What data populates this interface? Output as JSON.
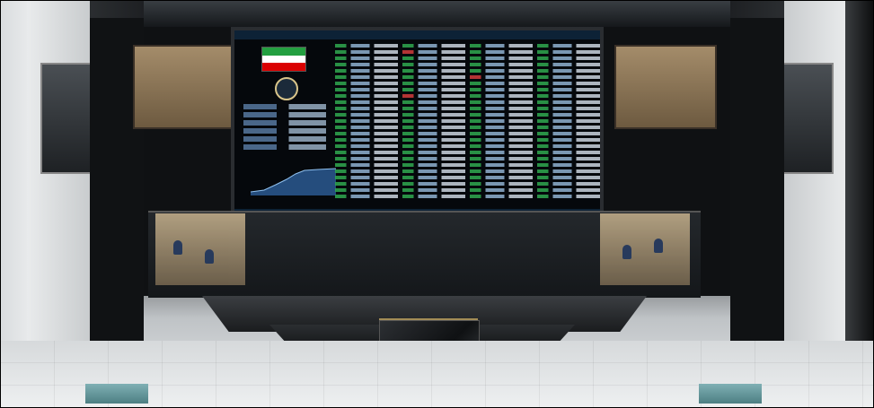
{
  "image": {
    "width": 973,
    "height": 455,
    "subject": "stock-exchange-trading-hall",
    "colors": {
      "board_bg": "#05080c",
      "up_green": "#2fa84f",
      "down_red": "#d23b3b",
      "flag_green": "#239f40",
      "flag_red": "#da0000"
    }
  }
}
